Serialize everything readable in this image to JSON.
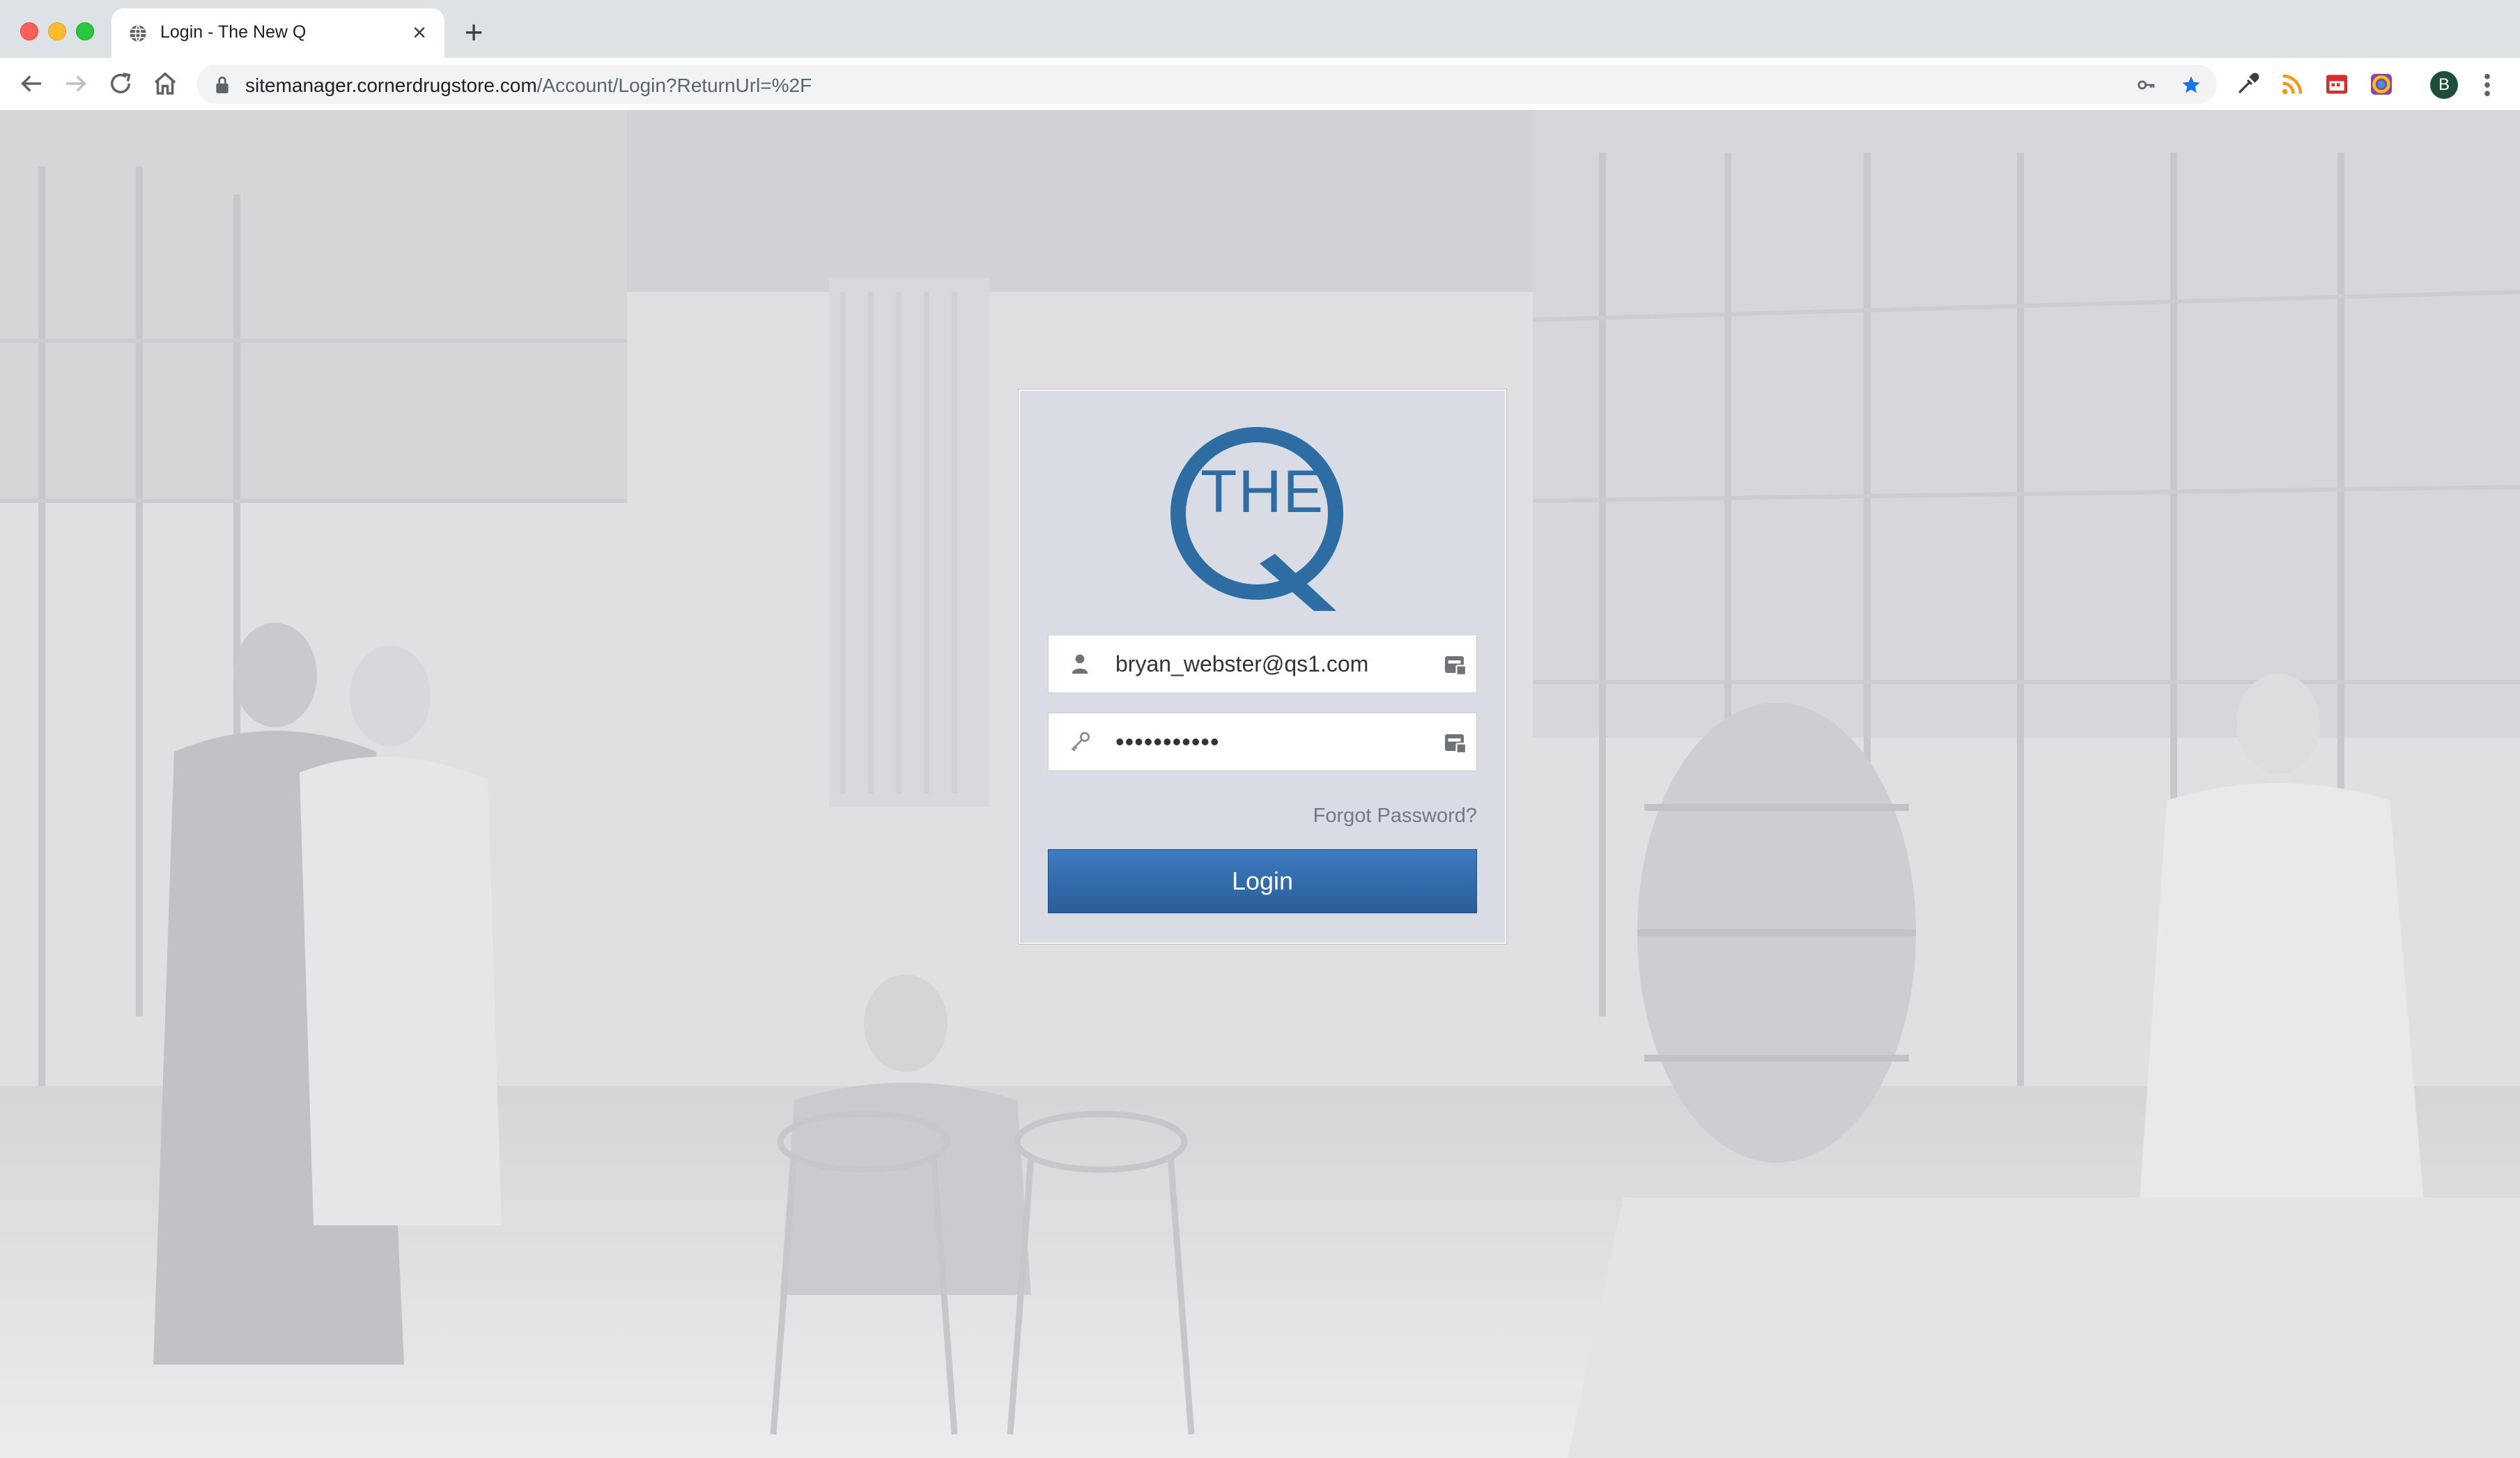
{
  "browser": {
    "tab": {
      "title": "Login - The New Q",
      "close_icon": "close-icon",
      "favicon": "globe-icon"
    },
    "new_tab_label": "+",
    "address_bar": {
      "host": "sitemanager.cornerdrugstore.com",
      "path": "/Account/Login?ReturnUrl=%2F"
    },
    "profile_initial": "B"
  },
  "login": {
    "logo_text": "THE",
    "username": {
      "value": "bryan_webster@qs1.com",
      "icon": "user-icon"
    },
    "password": {
      "value": "•••••••••••",
      "icon": "key-icon"
    },
    "forgot_password_label": "Forgot Password?",
    "login_button_label": "Login"
  },
  "colors": {
    "brand_blue": "#2e6da4",
    "button_top": "#3d7bc0",
    "button_bottom": "#2a5e99"
  }
}
